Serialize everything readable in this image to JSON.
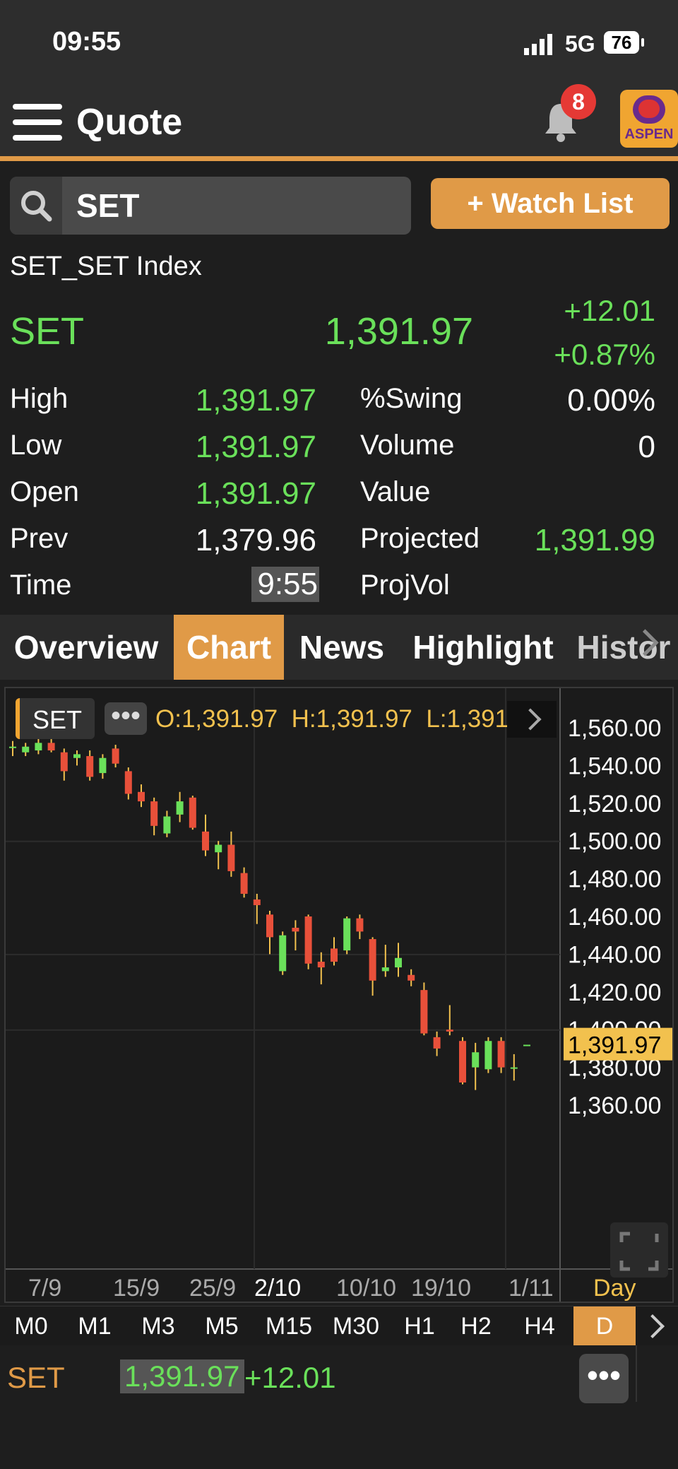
{
  "status": {
    "time": "09:55",
    "network": "5G",
    "battery": "76"
  },
  "appbar": {
    "title": "Quote",
    "notif_count": "8",
    "logo_text": "ASPEN"
  },
  "search": {
    "value": "SET",
    "watchlist_label": "+ Watch List"
  },
  "quote": {
    "name": "SET_SET Index",
    "symbol": "SET",
    "price": "1,391.97",
    "change": "+12.01",
    "pct_change": "+0.87%",
    "left": [
      {
        "label": "High",
        "value": "1,391.97"
      },
      {
        "label": "Low",
        "value": "1,391.97"
      },
      {
        "label": "Open",
        "value": "1,391.97"
      },
      {
        "label": "Prev",
        "value": "1,379.96"
      },
      {
        "label": "Time",
        "value": "9:55"
      }
    ],
    "right": [
      {
        "label": "%Swing",
        "value": "0.00%"
      },
      {
        "label": "Volume",
        "value": "0"
      },
      {
        "label": "Value",
        "value": ""
      },
      {
        "label": "Projected",
        "value": "1,391.99"
      },
      {
        "label": "ProjVol",
        "value": ""
      }
    ]
  },
  "tabs": [
    "Overview",
    "Chart",
    "News",
    "Highlight",
    "Histor"
  ],
  "active_tab": "Chart",
  "chart_data": {
    "type": "candlestick",
    "symbol_chip": "SET",
    "ohlc_text": "O:1,391.97  H:1,391.97  L:1,391",
    "x_ticks": [
      "7/9",
      "15/9",
      "25/9",
      "2/10",
      "10/10",
      "19/10",
      "1/11"
    ],
    "y_ticks": [
      "1,560.00",
      "1,540.00",
      "1,520.00",
      "1,500.00",
      "1,480.00",
      "1,460.00",
      "1,440.00",
      "1,420.00",
      "1,400.00",
      "1,380.00",
      "1,360.00"
    ],
    "ylim": [
      1350,
      1570
    ],
    "last_price_label": "1,391.97",
    "period_label": "Day",
    "candles": [
      {
        "o": 1550,
        "h": 1553,
        "l": 1545,
        "c": 1550
      },
      {
        "o": 1547,
        "h": 1552,
        "l": 1545,
        "c": 1550
      },
      {
        "o": 1548,
        "h": 1555,
        "l": 1546,
        "c": 1552
      },
      {
        "o": 1552,
        "h": 1554,
        "l": 1547,
        "c": 1548
      },
      {
        "o": 1547,
        "h": 1549,
        "l": 1532,
        "c": 1537
      },
      {
        "o": 1544,
        "h": 1548,
        "l": 1540,
        "c": 1546
      },
      {
        "o": 1545,
        "h": 1548,
        "l": 1532,
        "c": 1534
      },
      {
        "o": 1536,
        "h": 1546,
        "l": 1533,
        "c": 1544
      },
      {
        "o": 1549,
        "h": 1551,
        "l": 1539,
        "c": 1541
      },
      {
        "o": 1537,
        "h": 1539,
        "l": 1522,
        "c": 1525
      },
      {
        "o": 1526,
        "h": 1530,
        "l": 1518,
        "c": 1521
      },
      {
        "o": 1521,
        "h": 1523,
        "l": 1503,
        "c": 1508
      },
      {
        "o": 1504,
        "h": 1516,
        "l": 1502,
        "c": 1513
      },
      {
        "o": 1514,
        "h": 1526,
        "l": 1510,
        "c": 1521
      },
      {
        "o": 1523,
        "h": 1524,
        "l": 1506,
        "c": 1507
      },
      {
        "o": 1505,
        "h": 1514,
        "l": 1492,
        "c": 1495
      },
      {
        "o": 1494,
        "h": 1500,
        "l": 1485,
        "c": 1498
      },
      {
        "o": 1498,
        "h": 1505,
        "l": 1481,
        "c": 1484
      },
      {
        "o": 1483,
        "h": 1486,
        "l": 1470,
        "c": 1472
      },
      {
        "o": 1469,
        "h": 1472,
        "l": 1456,
        "c": 1466
      },
      {
        "o": 1461,
        "h": 1463,
        "l": 1440,
        "c": 1449
      },
      {
        "o": 1431,
        "h": 1452,
        "l": 1429,
        "c": 1450
      },
      {
        "o": 1454,
        "h": 1458,
        "l": 1442,
        "c": 1452
      },
      {
        "o": 1460,
        "h": 1461,
        "l": 1432,
        "c": 1435
      },
      {
        "o": 1436,
        "h": 1441,
        "l": 1424,
        "c": 1433
      },
      {
        "o": 1443,
        "h": 1449,
        "l": 1434,
        "c": 1436
      },
      {
        "o": 1442,
        "h": 1460,
        "l": 1440,
        "c": 1459
      },
      {
        "o": 1459,
        "h": 1461,
        "l": 1448,
        "c": 1452
      },
      {
        "o": 1448,
        "h": 1449,
        "l": 1418,
        "c": 1426
      },
      {
        "o": 1431,
        "h": 1445,
        "l": 1428,
        "c": 1433
      },
      {
        "o": 1433,
        "h": 1446,
        "l": 1428,
        "c": 1438
      },
      {
        "o": 1429,
        "h": 1432,
        "l": 1423,
        "c": 1426
      },
      {
        "o": 1421,
        "h": 1425,
        "l": 1397,
        "c": 1398
      },
      {
        "o": 1396,
        "h": 1399,
        "l": 1386,
        "c": 1390
      },
      {
        "o": 1400,
        "h": 1413,
        "l": 1397,
        "c": 1399
      },
      {
        "o": 1394,
        "h": 1396,
        "l": 1371,
        "c": 1372
      },
      {
        "o": 1380,
        "h": 1393,
        "l": 1368,
        "c": 1388
      },
      {
        "o": 1379,
        "h": 1396,
        "l": 1377,
        "c": 1394
      },
      {
        "o": 1394,
        "h": 1396,
        "l": 1377,
        "c": 1380
      },
      {
        "o": 1380,
        "h": 1387,
        "l": 1373,
        "c": 1380
      },
      {
        "o": 1392,
        "h": 1392,
        "l": 1392,
        "c": 1392
      }
    ]
  },
  "timeframes": [
    "M0",
    "M1",
    "M3",
    "M5",
    "M15",
    "M30",
    "H1",
    "H2",
    "H4",
    "D"
  ],
  "active_timeframe": "D",
  "ticker": {
    "symbol": "SET",
    "price": "1,391.97",
    "change": "+12.01"
  },
  "colors": {
    "accent": "#e09a47",
    "up": "#6ae05a",
    "down": "#e8503a",
    "yellow": "#f2c14e"
  },
  "icons": {
    "menu": "hamburger-icon",
    "bell": "bell-icon",
    "search": "search-icon",
    "more": "more-icon"
  }
}
